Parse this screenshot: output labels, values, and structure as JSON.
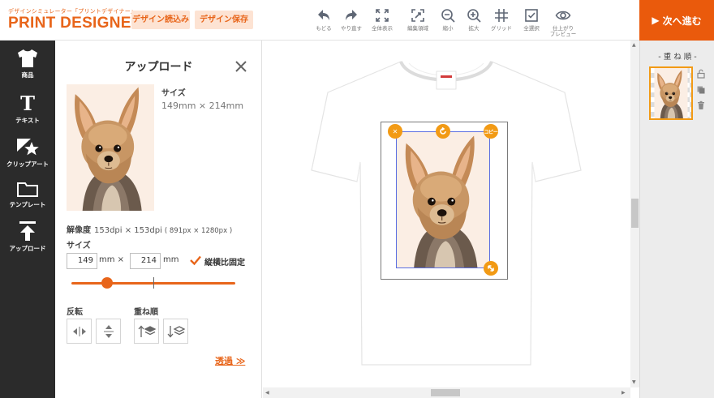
{
  "header": {
    "logo_sub": "デザインシミュレーター「プリントデザイナー」",
    "logo_main": "PRINT DESIGNER",
    "load_button": "デザイン読込み",
    "save_button": "デザイン保存",
    "next_button": "次へ進む",
    "tools": [
      {
        "label": "もどる",
        "icon": "undo-icon"
      },
      {
        "label": "やり直す",
        "icon": "redo-icon"
      },
      {
        "label": "全体表示",
        "icon": "fit-view-icon"
      },
      {
        "label": "編集領域",
        "icon": "edit-area-icon"
      },
      {
        "label": "縮小",
        "icon": "zoom-out-icon"
      },
      {
        "label": "拡大",
        "icon": "zoom-in-icon"
      },
      {
        "label": "グリッド",
        "icon": "grid-icon"
      },
      {
        "label": "全選択",
        "icon": "select-all-icon"
      },
      {
        "label": "仕上がり",
        "label2": "プレビュー",
        "icon": "preview-eye-icon"
      }
    ]
  },
  "nav": {
    "items": [
      {
        "label": "商品",
        "icon": "tshirt-icon"
      },
      {
        "label": "テキスト",
        "icon": "text-icon"
      },
      {
        "label": "クリップアート",
        "icon": "clipart-icon"
      },
      {
        "label": "テンプレート",
        "icon": "folder-icon"
      },
      {
        "label": "アップロード",
        "icon": "upload-icon"
      }
    ]
  },
  "panel": {
    "title": "アップロード",
    "size_label": "サイズ",
    "size_value": "149mm × 214mm",
    "resolution_label": "解像度",
    "resolution_value": "153dpi × 153dpi",
    "resolution_px": "( 891px × 1280px )",
    "size_input_label": "サイズ",
    "width_value": "149",
    "height_value": "214",
    "unit_mm": "mm",
    "times": "×",
    "keep_ratio_label": "縦横比固定",
    "keep_ratio_checked": true,
    "slider_fraction": 0.22,
    "flip_label": "反転",
    "order_label": "重ね順",
    "transparency_link": "透過 ≫"
  },
  "canvas": {
    "copy_handle_label": "コピー"
  },
  "layers": {
    "title": "- 重 ね 順 -"
  },
  "colors": {
    "accent": "#e8651a",
    "next_button": "#ea5a0c",
    "handle": "#f29a14",
    "nav_bg": "#2b2b2b",
    "selection_border": "#5b6ee1"
  }
}
